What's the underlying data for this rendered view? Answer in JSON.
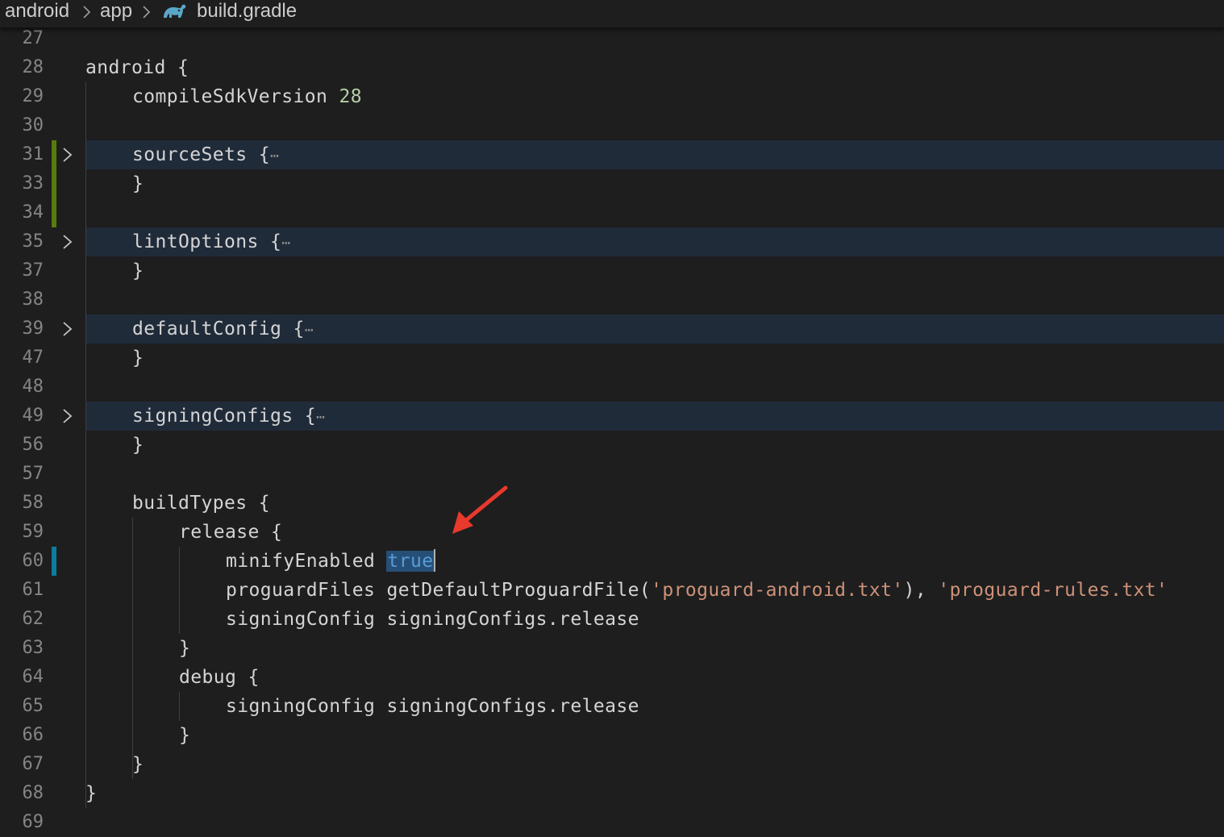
{
  "breadcrumb": {
    "items": [
      "android",
      "app",
      "build.gradle"
    ],
    "icon": "gradle-elephant-icon"
  },
  "colors": {
    "background": "#1e1e1e",
    "fold_highlight": "#202b3a",
    "string": "#ce9178",
    "number": "#b5cea8",
    "keyword": "#569cd6",
    "selection": "#264f78",
    "added_gutter": "#587c0c",
    "modified_gutter": "#0c7d9d",
    "annotation_arrow": "#e8392c"
  },
  "editor": {
    "lines": [
      {
        "n": "27",
        "indent": 0,
        "parts": []
      },
      {
        "n": "28",
        "indent": 0,
        "parts": [
          {
            "t": "android {"
          }
        ]
      },
      {
        "n": "29",
        "indent": 1,
        "parts": [
          {
            "t": "compileSdkVersion "
          },
          {
            "t": "28",
            "c": "num"
          }
        ]
      },
      {
        "n": "30",
        "indent": 0,
        "parts": []
      },
      {
        "n": "31",
        "indent": 1,
        "parts": [
          {
            "t": "sourceSets {"
          }
        ],
        "folded": true,
        "gutter": "added"
      },
      {
        "n": "33",
        "indent": 1,
        "parts": [
          {
            "t": "}"
          }
        ],
        "gutter": "added"
      },
      {
        "n": "34",
        "indent": 0,
        "parts": [],
        "gutter": "added"
      },
      {
        "n": "35",
        "indent": 1,
        "parts": [
          {
            "t": "lintOptions {"
          }
        ],
        "folded": true
      },
      {
        "n": "37",
        "indent": 1,
        "parts": [
          {
            "t": "}"
          }
        ]
      },
      {
        "n": "38",
        "indent": 0,
        "parts": []
      },
      {
        "n": "39",
        "indent": 1,
        "parts": [
          {
            "t": "defaultConfig {"
          }
        ],
        "folded": true
      },
      {
        "n": "47",
        "indent": 1,
        "parts": [
          {
            "t": "}"
          }
        ]
      },
      {
        "n": "48",
        "indent": 0,
        "parts": []
      },
      {
        "n": "49",
        "indent": 1,
        "parts": [
          {
            "t": "signingConfigs {"
          }
        ],
        "folded": true
      },
      {
        "n": "56",
        "indent": 1,
        "parts": [
          {
            "t": "}"
          }
        ]
      },
      {
        "n": "57",
        "indent": 0,
        "parts": []
      },
      {
        "n": "58",
        "indent": 1,
        "parts": [
          {
            "t": "buildTypes {"
          }
        ]
      },
      {
        "n": "59",
        "indent": 2,
        "parts": [
          {
            "t": "release {"
          }
        ]
      },
      {
        "n": "60",
        "indent": 3,
        "parts": [
          {
            "t": "minifyEnabled "
          },
          {
            "t": "true",
            "c": "kw-true",
            "caret": true
          }
        ],
        "gutter": "modified"
      },
      {
        "n": "61",
        "indent": 3,
        "parts": [
          {
            "t": "proguardFiles getDefaultProguardFile("
          },
          {
            "t": "'proguard-android.txt'",
            "c": "str"
          },
          {
            "t": "), "
          },
          {
            "t": "'proguard-rules.txt'",
            "c": "str"
          }
        ]
      },
      {
        "n": "62",
        "indent": 3,
        "parts": [
          {
            "t": "signingConfig signingConfigs.release"
          }
        ]
      },
      {
        "n": "63",
        "indent": 2,
        "parts": [
          {
            "t": "}"
          }
        ]
      },
      {
        "n": "64",
        "indent": 2,
        "parts": [
          {
            "t": "debug {"
          }
        ]
      },
      {
        "n": "65",
        "indent": 3,
        "parts": [
          {
            "t": "signingConfig signingConfigs.release"
          }
        ]
      },
      {
        "n": "66",
        "indent": 2,
        "parts": [
          {
            "t": "}"
          }
        ]
      },
      {
        "n": "67",
        "indent": 1,
        "parts": [
          {
            "t": "}"
          }
        ]
      },
      {
        "n": "68",
        "indent": 0,
        "parts": [
          {
            "t": "}"
          }
        ]
      },
      {
        "n": "69",
        "indent": 0,
        "parts": []
      }
    ]
  },
  "annotation": {
    "icon": "red-arrow-icon"
  }
}
